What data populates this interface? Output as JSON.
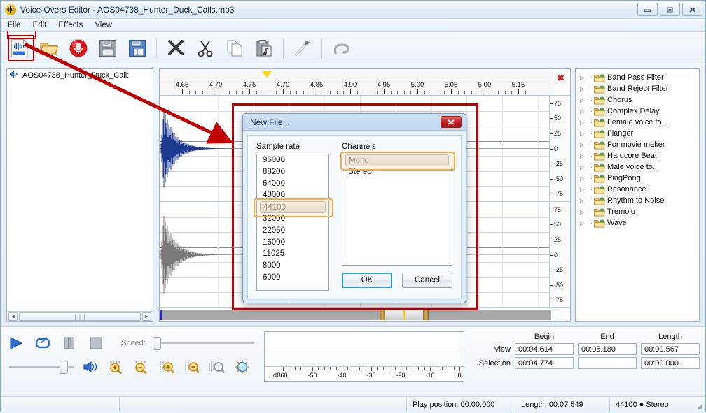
{
  "window": {
    "title": "Voice-Overs Editor - AOS04738_Hunter_Duck_Calls.mp3",
    "icon": "waveform-icon",
    "minimize": "–",
    "maximize": "□",
    "close": "✕"
  },
  "menu": {
    "items": [
      {
        "label": "File"
      },
      {
        "label": "Edit"
      },
      {
        "label": "Effects"
      },
      {
        "label": "View"
      }
    ]
  },
  "toolbar": {
    "buttons": [
      {
        "name": "new-file-icon",
        "tip": "New File"
      },
      {
        "name": "open-file-icon",
        "tip": "Open"
      },
      {
        "name": "record-icon",
        "tip": "Record"
      },
      {
        "name": "save-icon",
        "tip": "Save"
      },
      {
        "name": "save-as-icon",
        "tip": "Save As"
      },
      {
        "name": "delete-icon",
        "tip": "Delete"
      },
      {
        "name": "cut-icon",
        "tip": "Cut"
      },
      {
        "name": "copy-icon",
        "tip": "Copy"
      },
      {
        "name": "paste-icon",
        "tip": "Paste"
      },
      {
        "name": "magic-wand-icon",
        "tip": "Effects"
      },
      {
        "name": "undo-icon",
        "tip": "Undo"
      }
    ]
  },
  "file_panel": {
    "items": [
      {
        "label": "AOS04738_Hunter_Duck_Call:"
      }
    ],
    "scroll_left": "◄",
    "scroll_right": "►",
    "thumb_grip": "❘❘❘"
  },
  "editor": {
    "close_icon": "✖",
    "ruler_labels": [
      "4.65",
      "4.70",
      "4.75",
      "4.70",
      "4.85",
      "4.90",
      "4.95",
      "5.00",
      "5.05",
      "5.00",
      "5.15"
    ],
    "amplitude_labels": [
      "75",
      "50",
      "25",
      "0",
      "-25",
      "-50",
      "-75"
    ]
  },
  "effects": {
    "items": [
      {
        "label": "Band Pass Filter"
      },
      {
        "label": "Band Reject Filter"
      },
      {
        "label": "Chorus"
      },
      {
        "label": "Complex Delay"
      },
      {
        "label": "Female voice to..."
      },
      {
        "label": "Flanger"
      },
      {
        "label": "For movie maker"
      },
      {
        "label": "Hardcore Beat"
      },
      {
        "label": "Male voice to..."
      },
      {
        "label": "PingPong"
      },
      {
        "label": "Resonance"
      },
      {
        "label": "Rhythm to Noise"
      },
      {
        "label": "Tremolo"
      },
      {
        "label": "Wave"
      }
    ],
    "expander": "▷"
  },
  "transport": {
    "play": "play-icon",
    "loop": "loop-icon",
    "pause": "pause-icon",
    "stop": "stop-icon",
    "speed_label": "Speed:",
    "volume_icon": "speaker-icon",
    "zoom_buttons": [
      "zoom-in-horizontal-icon",
      "zoom-out-horizontal-icon",
      "zoom-in-vertical-icon",
      "zoom-out-vertical-icon",
      "zoom-selection-icon",
      "zoom-full-icon"
    ]
  },
  "meter": {
    "unit_label": "dB",
    "scale_labels": [
      "-60",
      "-50",
      "-40",
      "-30",
      "-20",
      "-10",
      "0"
    ]
  },
  "info": {
    "headers": {
      "begin": "Begin",
      "end": "End",
      "length": "Length"
    },
    "rows": [
      {
        "label": "View",
        "begin": "00:04.614",
        "end": "00:05.180",
        "length": "00:00.567"
      },
      {
        "label": "Selection",
        "begin": "00:04.774",
        "end": "",
        "length": "00:00.000"
      }
    ]
  },
  "statusbar": {
    "cells": [
      "",
      "",
      "Play position: 00:00.000",
      "Length: 00:07.549",
      "44100 ● Stereo"
    ]
  },
  "dialog": {
    "title": "New File...",
    "close": "✖",
    "sample_rate_label": "Sample rate",
    "sample_rates": [
      "96000",
      "88200",
      "64000",
      "48000",
      "44100",
      "32000",
      "22050",
      "16000",
      "11025",
      "8000",
      "6000"
    ],
    "selected_sample_rate": "44100",
    "channels_label": "Channels",
    "channels": [
      "Mono",
      "Stereo"
    ],
    "selected_channel": "Mono",
    "ok_label": "OK",
    "cancel_label": "Cancel"
  },
  "colors": {
    "annotation": "#c00000",
    "highlight": "#f0ad4e",
    "waveform": "#1e3a8f",
    "waveform_secondary": "#7a7a7a",
    "marker": "#ffd400"
  }
}
